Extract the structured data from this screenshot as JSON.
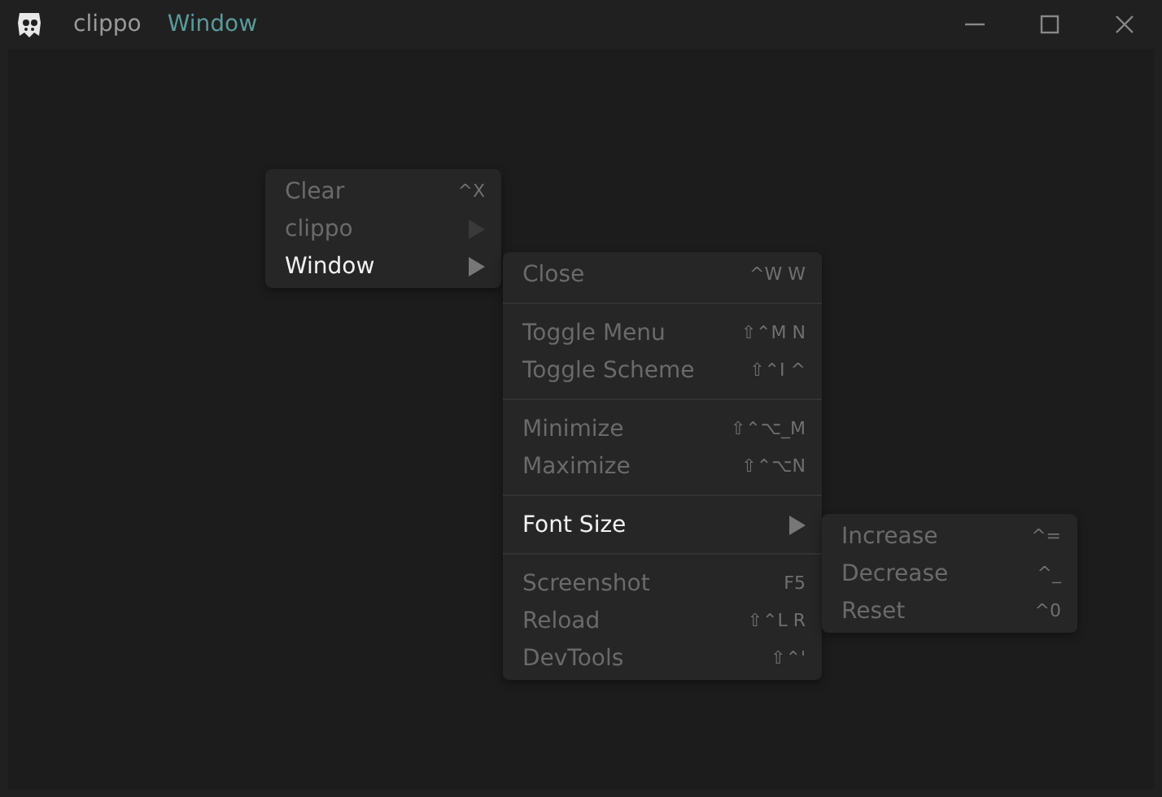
{
  "menubar": [
    {
      "label": "clippo"
    },
    {
      "label": "Window"
    }
  ],
  "menus": [
    {
      "items": [
        {
          "kind": "item",
          "label": "Clear",
          "shortcut": "^X",
          "selected": false
        },
        {
          "kind": "submenu",
          "label": "clippo",
          "selected": false
        },
        {
          "kind": "submenu",
          "label": "Window",
          "selected": true
        }
      ]
    },
    {
      "items": [
        {
          "kind": "item",
          "label": "Close",
          "shortcut": "^W W",
          "selected": false
        },
        {
          "kind": "separator"
        },
        {
          "kind": "item",
          "label": "Toggle Menu",
          "shortcut": "⇧⌃M N",
          "selected": false
        },
        {
          "kind": "item",
          "label": "Toggle Scheme",
          "shortcut": "⇧⌃I ^",
          "selected": false
        },
        {
          "kind": "separator"
        },
        {
          "kind": "item",
          "label": "Minimize",
          "shortcut": "⇧⌃⌥_M",
          "selected": false
        },
        {
          "kind": "item",
          "label": "Maximize",
          "shortcut": "⇧⌃⌥N",
          "selected": false
        },
        {
          "kind": "separator"
        },
        {
          "kind": "submenu",
          "label": "Font Size",
          "selected": true
        },
        {
          "kind": "separator"
        },
        {
          "kind": "item",
          "label": "Screenshot",
          "shortcut": "F5",
          "selected": false
        },
        {
          "kind": "item",
          "label": "Reload",
          "shortcut": "⇧⌃L R",
          "selected": false
        },
        {
          "kind": "item",
          "label": "DevTools",
          "shortcut": "⇧⌃'",
          "selected": false
        }
      ]
    },
    {
      "items": [
        {
          "kind": "item",
          "label": "Increase",
          "shortcut": "^=",
          "selected": false
        },
        {
          "kind": "item",
          "label": "Decrease",
          "shortcut": "^_",
          "selected": false
        },
        {
          "kind": "item",
          "label": "Reset",
          "shortcut": "^0",
          "selected": false
        }
      ]
    }
  ]
}
